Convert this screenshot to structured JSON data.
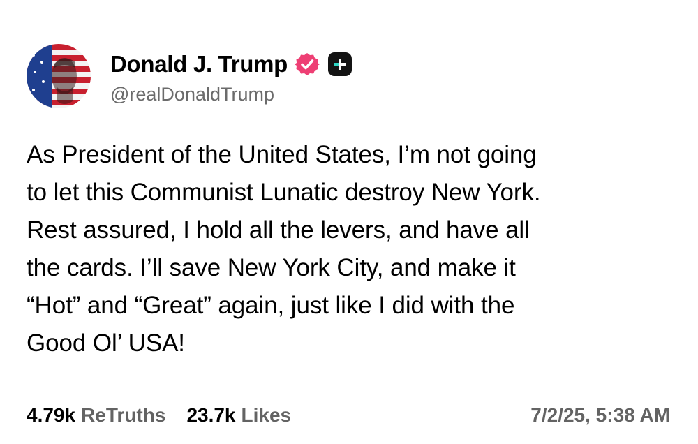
{
  "author": {
    "display_name": "Donald J. Trump",
    "handle": "@realDonaldTrump",
    "avatar_icon": "flag-portrait-avatar",
    "verified_icon": "verified-badge-icon",
    "plus_icon": "truth-plus-badge-icon"
  },
  "post": {
    "lines": [
      "As President of the United States, I’m not going",
      "to let this Communist Lunatic destroy New York.",
      "Rest assured, I hold all the levers, and have all",
      "the cards. I’ll save New York City, and make it",
      "“Hot” and “Great” again, just like I did with the",
      "Good Ol’ USA!"
    ]
  },
  "stats": {
    "retruths_count": "4.79k",
    "retruths_label": "ReTruths",
    "likes_count": "23.7k",
    "likes_label": "Likes",
    "timestamp": "7/2/25, 5:38 AM"
  },
  "colors": {
    "verified_pink": "#ee3f74",
    "plus_dark": "#141414",
    "plus_teal": "#2fd6c4",
    "muted_text": "#636363"
  }
}
